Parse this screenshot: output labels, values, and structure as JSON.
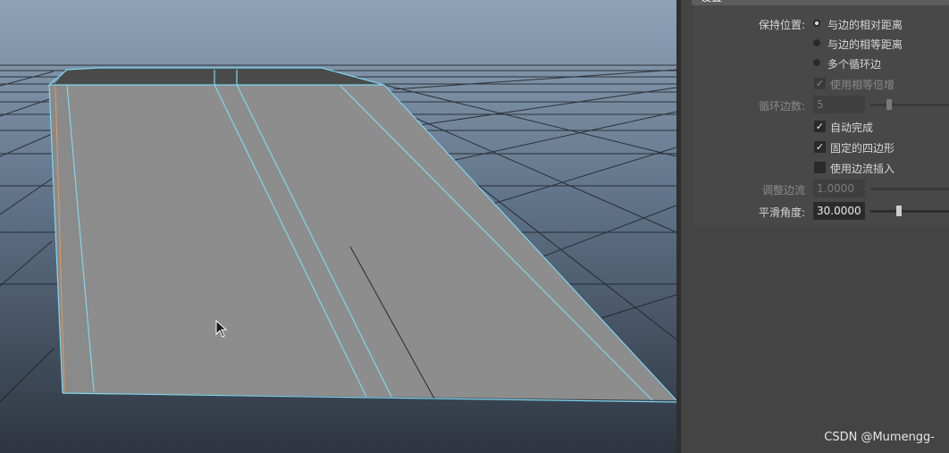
{
  "panel": {
    "section_title": "设置",
    "keep_position_label": "保持位置:",
    "keep_position_options": [
      {
        "label": "与边的相对距离",
        "selected": true
      },
      {
        "label": "与边的相等距离",
        "selected": false
      },
      {
        "label": "多个循环边",
        "selected": false
      }
    ],
    "use_equal_multiplier": {
      "label": "使用相等倍增",
      "checked": true,
      "enabled": false
    },
    "loop_count": {
      "label": "循环边数:",
      "value": "5",
      "enabled": false,
      "slider_fraction": 0.1
    },
    "auto_complete": {
      "label": "自动完成",
      "checked": true
    },
    "fixed_quad": {
      "label": "固定的四边形",
      "checked": true
    },
    "use_edge_flow": {
      "label": "使用边流插入",
      "checked": false
    },
    "adjust_edge_flow": {
      "label": "调整边流",
      "value": "1.0000",
      "enabled": false
    },
    "smoothing_angle": {
      "label": "平滑角度:",
      "value": "30.0000",
      "slider_fraction": 0.35
    }
  },
  "watermark": "CSDN @Mumengg-",
  "colors": {
    "viewport_top": "#8fa3b8",
    "viewport_bottom": "#2e3540",
    "mesh_fill": "#8d8d8d",
    "edge_highlight": "#7fd6ee",
    "panel_bg": "#444444"
  },
  "icons": {
    "cursor": "arrow-cursor-icon",
    "check": "checkmark-icon"
  }
}
